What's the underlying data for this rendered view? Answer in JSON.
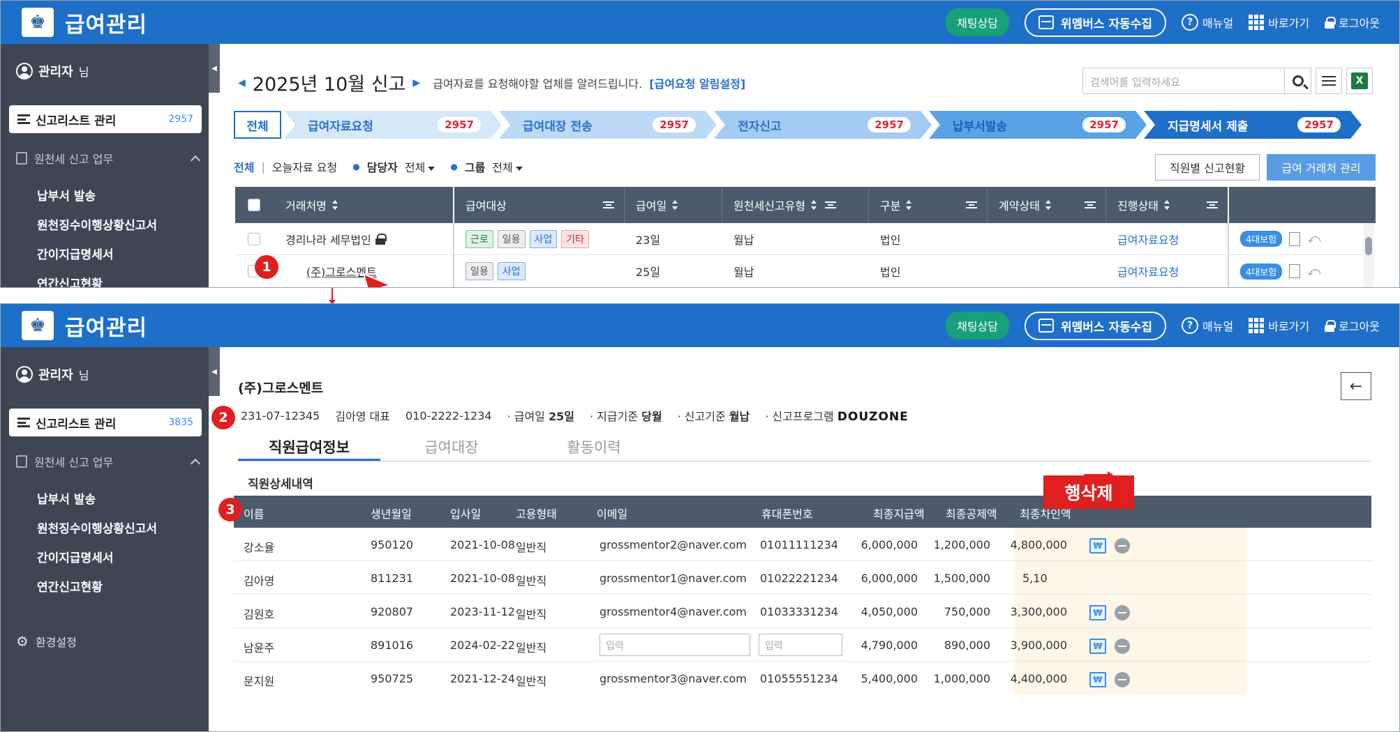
{
  "app": {
    "title": "급여관리"
  },
  "topbar": {
    "chat": "채팅상담",
    "auto_collect": "위멤버스 자동수집",
    "manual": "매뉴얼",
    "shortcut": "바로가기",
    "logout": "로그아웃"
  },
  "sidebar": {
    "admin": "관리자",
    "admin_suffix": "님",
    "active_menu": "신고리스트 관리",
    "count_top": "2957",
    "count_bottom": "3835",
    "section": "원천세 신고 업무",
    "items": [
      "납부서 발송",
      "원천징수이행상황신고서",
      "간이지급명세서",
      "연간신고현황"
    ],
    "settings": "환경설정"
  },
  "list": {
    "period": "2025년 10월 신고",
    "message": "급여자료를 요청해야할 업체를 알려드립니다.",
    "alert_setting": "[급여요청 알림설정]",
    "search_placeholder": "검색어를 입력하세요",
    "excel": "X",
    "steps": {
      "all": "전체",
      "items": [
        {
          "label": "급여자료요청",
          "count": "2957"
        },
        {
          "label": "급여대장 전송",
          "count": "2957"
        },
        {
          "label": "전자신고",
          "count": "2957"
        },
        {
          "label": "납부서발송",
          "count": "2957"
        },
        {
          "label": "지급명세서 제출",
          "count": "2957"
        }
      ]
    },
    "filter": {
      "all": "전체",
      "today": "오늘자료 요청",
      "manager_label": "담당자",
      "manager_value": "전체",
      "group_label": "그룹",
      "group_value": "전체"
    },
    "btn_status": "직원별 신고현황",
    "btn_manage": "급여 거래처 관리",
    "headers": [
      "거래처명",
      "급여대상",
      "급여일",
      "원천세신고유형",
      "구분",
      "계약상태",
      "진행상태"
    ],
    "rows": [
      {
        "name": "경리나라 세무법인",
        "tags": [
          "근로",
          "일용",
          "사업",
          "기타"
        ],
        "payday": "23일",
        "type": "월납",
        "kind": "법인",
        "status": "급여자료요청",
        "ins": "4대보험"
      },
      {
        "name": "(주)그로스멘트",
        "tags": [
          "일용",
          "사업"
        ],
        "payday": "25일",
        "type": "월납",
        "kind": "법인",
        "status": "급여자료요청",
        "ins": "4대보험"
      }
    ]
  },
  "detail": {
    "company": "(주)그로스멘트",
    "biz_no": "231-07-12345",
    "ceo": "김아영 대표",
    "phone": "010-2222-1234",
    "payday_label": "· 급여일",
    "payday": "25일",
    "basis_label": "· 지급기준",
    "basis": "당월",
    "report_label": "· 신고기준",
    "report": "월납",
    "program_label": "· 신고프로그램",
    "program": "DOUZONE",
    "tabs": [
      "직원급여정보",
      "급여대장",
      "활동이력"
    ],
    "section_title": "직원상세내역",
    "headers": [
      "이름",
      "생년월일",
      "입사일",
      "고용형태",
      "이메일",
      "휴대폰번호",
      "최종지급액",
      "최종공제액",
      "최종차인액"
    ],
    "rows": [
      {
        "name": "강소율",
        "birth": "950120",
        "join": "2021-10-08",
        "type": "일반직",
        "email": "grossmentor2@naver.com",
        "phone": "01011111234",
        "pay": "6,000,000",
        "deduct": "1,200,000",
        "net": "4,800,000"
      },
      {
        "name": "김아영",
        "birth": "811231",
        "join": "2021-10-08",
        "type": "일반직",
        "email": "grossmentor1@naver.com",
        "phone": "01022221234",
        "pay": "6,000,000",
        "deduct": "1,500,000",
        "net": "5,10"
      },
      {
        "name": "김원호",
        "birth": "920807",
        "join": "2023-11-12",
        "type": "일반직",
        "email": "grossmentor4@naver.com",
        "phone": "01033331234",
        "pay": "4,050,000",
        "deduct": "750,000",
        "net": "3,300,000"
      },
      {
        "name": "남윤주",
        "birth": "891016",
        "join": "2024-02-22",
        "type": "일반직",
        "email": "",
        "phone": "",
        "pay": "4,790,000",
        "deduct": "890,000",
        "net": "3,900,000"
      },
      {
        "name": "문지원",
        "birth": "950725",
        "join": "2021-12-24",
        "type": "일반직",
        "email": "grossmentor3@naver.com",
        "phone": "01055551234",
        "pay": "5,400,000",
        "deduct": "1,000,000",
        "net": "4,400,000"
      }
    ],
    "input_placeholder": "입력",
    "delete_label": "행삭제"
  },
  "annotations": {
    "n1": "1",
    "n2": "2",
    "n3": "3"
  },
  "colors": {
    "brand": "#1e6fc8",
    "sidebar": "#3e4553",
    "header": "#4d5a6c",
    "alert": "#e02020"
  }
}
